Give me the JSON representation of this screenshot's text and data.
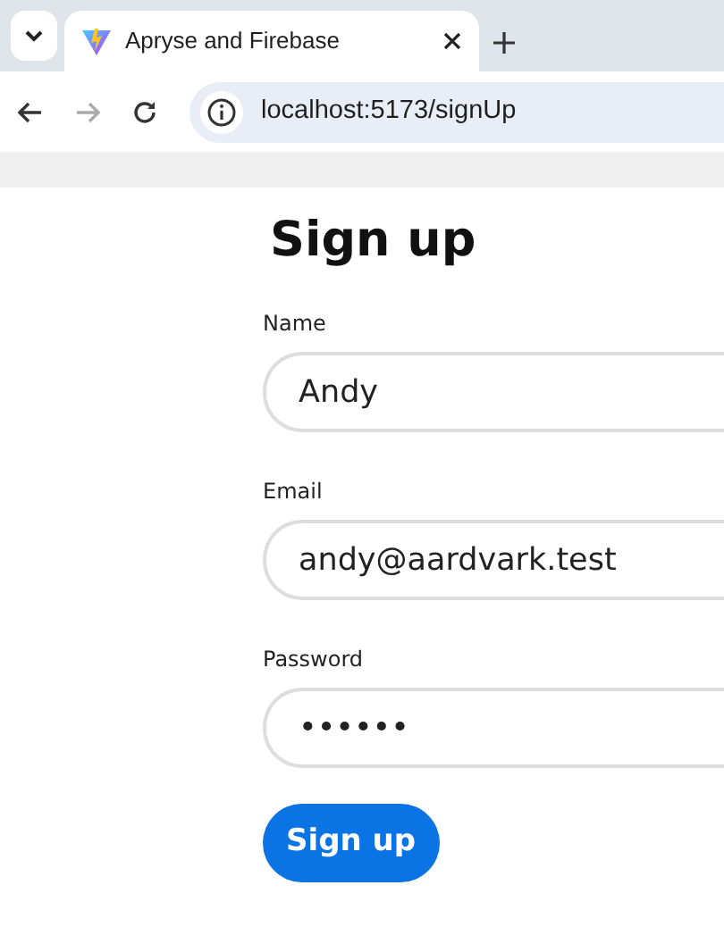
{
  "browser": {
    "tab": {
      "title": "Apryse and Firebase",
      "selected": true
    },
    "url": "localhost:5173/signUp"
  },
  "form": {
    "title": "Sign up",
    "fields": [
      {
        "label": "Name",
        "value": "Andy"
      },
      {
        "label": "Email",
        "value": "andy@aardvark.test"
      },
      {
        "label": "Password",
        "value": "••••••"
      }
    ],
    "submit": "Sign up"
  }
}
